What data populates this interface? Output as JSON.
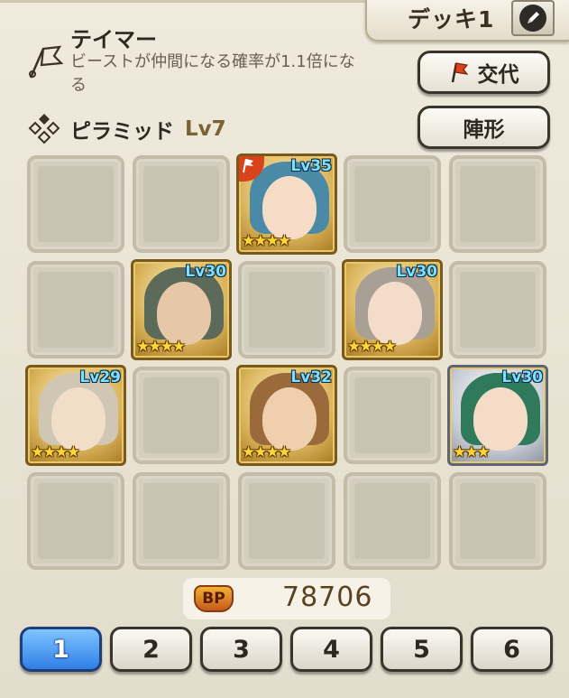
{
  "deck": {
    "title": "デッキ1"
  },
  "skill": {
    "title": "テイマー",
    "description_line1": "ビーストが仲間になる確率が1.1倍にな",
    "description_line2": "る"
  },
  "buttons": {
    "swap": "交代",
    "formation": "陣形"
  },
  "formation": {
    "name": "ピラミッド",
    "level": "Lv7"
  },
  "grid": {
    "rows": 4,
    "cols": 5,
    "units": [
      {
        "row": 0,
        "col": 2,
        "level": "Lv35",
        "stars": "★★★★",
        "leader": true,
        "frame": "gold",
        "hair": "#4a8aa6",
        "skin": "#f6dcc6"
      },
      {
        "row": 1,
        "col": 1,
        "level": "Lv30",
        "stars": "★★★★",
        "leader": false,
        "frame": "gold",
        "hair": "#5c6a5a",
        "skin": "#e6c8a8"
      },
      {
        "row": 1,
        "col": 3,
        "level": "Lv30",
        "stars": "★★★★",
        "leader": false,
        "frame": "gold",
        "hair": "#a8a094",
        "skin": "#f4dcca"
      },
      {
        "row": 2,
        "col": 0,
        "level": "Lv29",
        "stars": "★★★★",
        "leader": false,
        "frame": "gold",
        "hair": "#cfc6b4",
        "skin": "#f2ddc8"
      },
      {
        "row": 2,
        "col": 2,
        "level": "Lv32",
        "stars": "★★★★",
        "leader": false,
        "frame": "gold",
        "hair": "#9a6a3a",
        "skin": "#f0cfae"
      },
      {
        "row": 2,
        "col": 4,
        "level": "Lv30",
        "stars": "★★★",
        "leader": false,
        "frame": "silver",
        "hair": "#2f7a5a",
        "skin": "#f4dcc8"
      }
    ]
  },
  "bp": {
    "label": "BP",
    "value": "78706"
  },
  "deck_tabs": [
    {
      "label": "1",
      "active": true
    },
    {
      "label": "2",
      "active": false
    },
    {
      "label": "3",
      "active": false
    },
    {
      "label": "4",
      "active": false
    },
    {
      "label": "5",
      "active": false
    },
    {
      "label": "6",
      "active": false
    }
  ],
  "colors": {
    "active_tab": "#2f7fe6",
    "level_text": "#7de0ff",
    "star": "#ffd53a",
    "leader_badge": "#d9431c"
  }
}
